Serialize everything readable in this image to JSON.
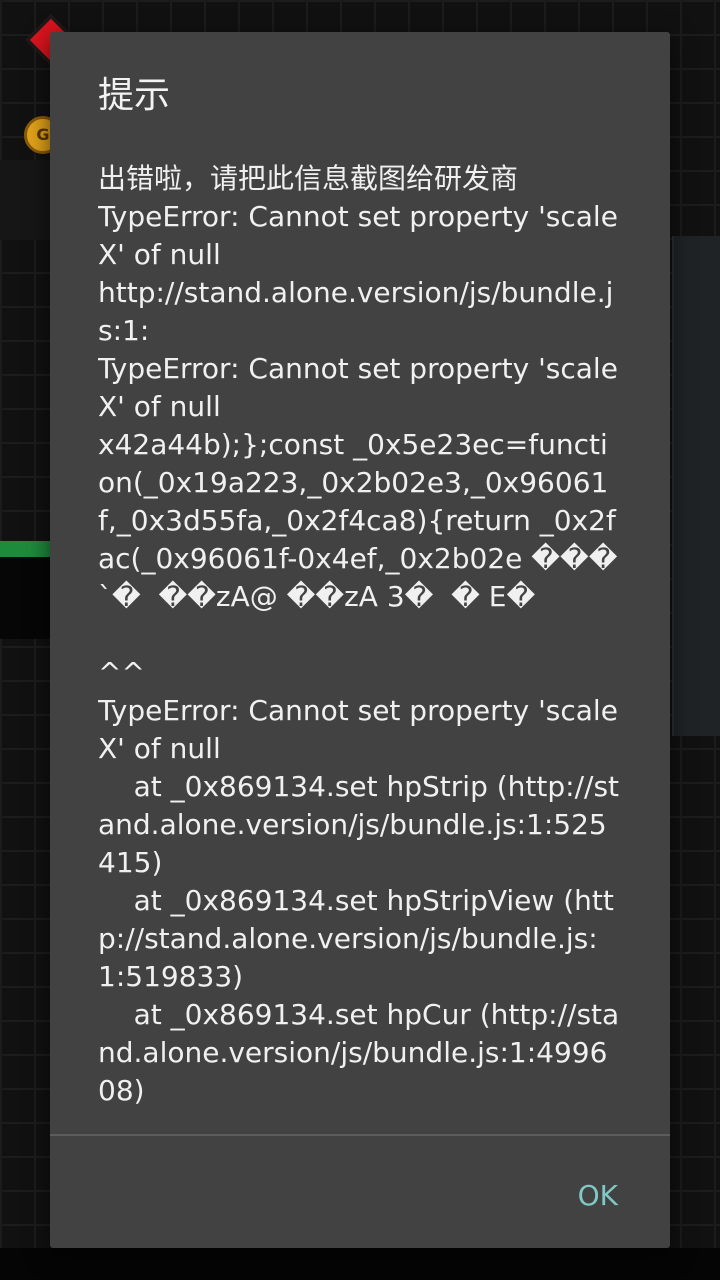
{
  "background": {
    "coin_letter": "G"
  },
  "dialog": {
    "title": "提示",
    "message": "出错啦，请把此信息截图给研发商\nTypeError: Cannot set property 'scaleX' of null\nhttp://stand.alone.version/js/bundle.js:1:\nTypeError: Cannot set property 'scaleX' of null\nx42a44b);};const _0x5e23ec=function(_0x19a223,_0x2b02e3,_0x96061f,_0x3d55fa,_0x2f4ca8){return _0x2fac(_0x96061f-0x4ef,_0x2b02e ���`�  ��zA@ ��zA 3�  � E�\n\n^^\nTypeError: Cannot set property 'scaleX' of null\n    at _0x869134.set hpStrip (http://stand.alone.version/js/bundle.js:1:525415)\n    at _0x869134.set hpStripView (http://stand.alone.version/js/bundle.js:1:519833)\n    at _0x869134.set hpCur (http://stand.alone.version/js/bundle.js:1:499608)",
    "ok_label": "OK"
  },
  "colors": {
    "dialog_bg": "#424242",
    "button_text": "#7fc8c5"
  }
}
